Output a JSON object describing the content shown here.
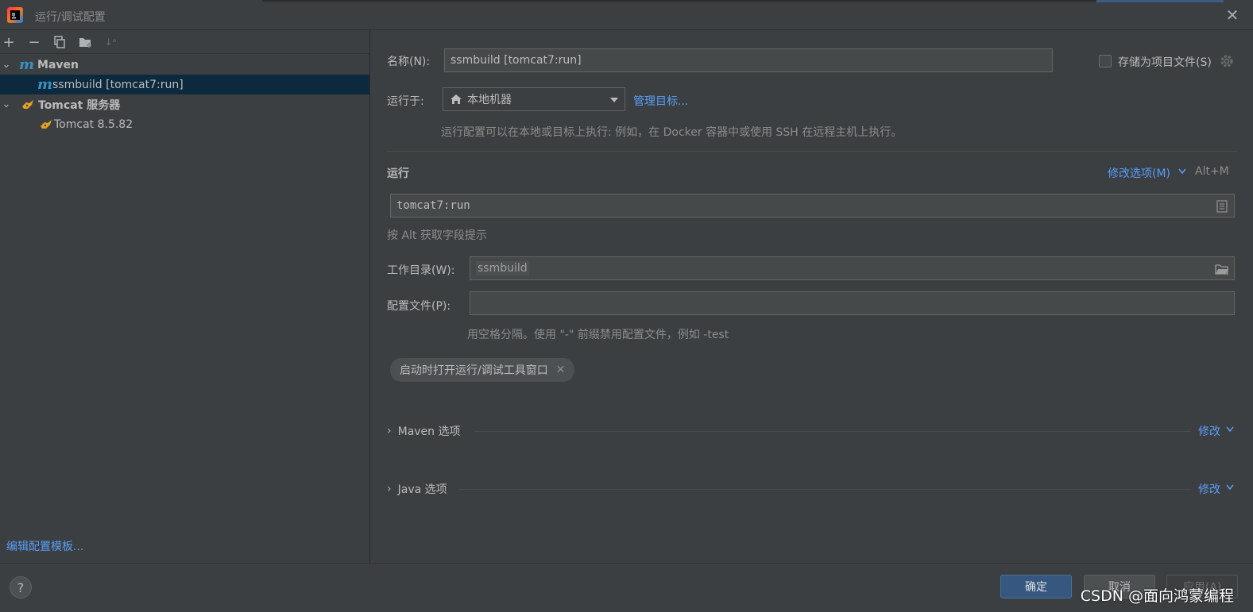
{
  "window": {
    "title": "运行/调试配置"
  },
  "left": {
    "tree": {
      "maven_group": "Maven",
      "maven_item": "ssmbuild [tomcat7:run]",
      "tomcat_group": "Tomcat 服务器",
      "tomcat_item": "Tomcat 8.5.82"
    },
    "edit_templates": "编辑配置模板..."
  },
  "form": {
    "name_label": "名称(N):",
    "name_value": "ssmbuild [tomcat7:run]",
    "store_label": "存储为项目文件(S)",
    "run_on_label": "运行于:",
    "run_on_value": "本地机器",
    "manage_targets": "管理目标...",
    "run_on_hint": "运行配置可以在本地或目标上执行: 例如，在 Docker 容器中或使用 SSH 在远程主机上执行。",
    "run_section": "运行",
    "modify_options": "修改选项(M)",
    "modify_shortcut": "Alt+M",
    "command_value": "tomcat7:run",
    "alt_hint": "按 Alt 获取字段提示",
    "workdir_label": "工作目录(W):",
    "workdir_value": "ssmbuild",
    "profiles_label": "配置文件(P):",
    "profiles_value": "",
    "profiles_hint": "用空格分隔。使用 \"-\" 前缀禁用配置文件，例如 -test",
    "chip_label": "启动时打开运行/调试工具窗口",
    "maven_options": "Maven 选项",
    "java_options": "Java 选项",
    "modify": "修改"
  },
  "footer": {
    "help": "?",
    "ok": "确定",
    "cancel": "取消",
    "apply": "应用(A)",
    "watermark": "CSDN @面向鸿蒙编程"
  },
  "colors": {
    "accent": "#589df6",
    "selection": "#0d293e",
    "primary_button": "#365880"
  }
}
